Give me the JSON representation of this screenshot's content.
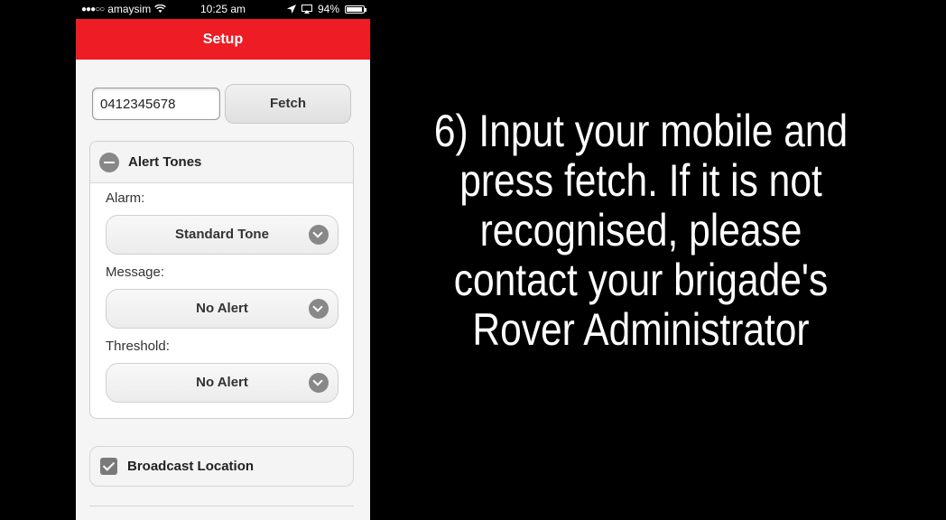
{
  "status_bar": {
    "signal": "●●●○○",
    "carrier": "amaysim",
    "wifi": "wifi",
    "time": "10:25 am",
    "battery_percent": "94%",
    "battery_level": 0.94
  },
  "header": {
    "title": "Setup"
  },
  "mobile": {
    "value": "0412345678",
    "fetch_label": "Fetch"
  },
  "alert_tones": {
    "title": "Alert Tones",
    "fields": [
      {
        "label": "Alarm:",
        "value": "Standard Tone"
      },
      {
        "label": "Message:",
        "value": "No Alert"
      },
      {
        "label": "Threshold:",
        "value": "No Alert"
      }
    ]
  },
  "broadcast": {
    "label": "Broadcast Location",
    "checked": true
  },
  "caption": {
    "lines": [
      "6) Input your mobile and",
      "press fetch. If it is not",
      "recognised, please",
      "contact your brigade's",
      "Rover Administrator"
    ]
  },
  "colors": {
    "header": "#ee1c25"
  }
}
